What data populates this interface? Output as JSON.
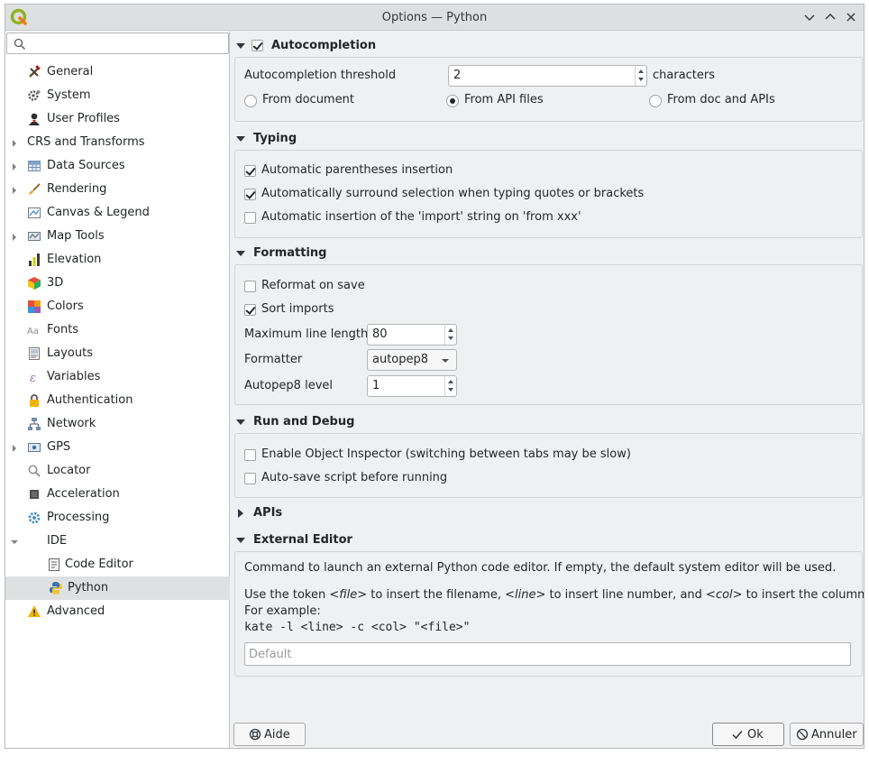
{
  "window": {
    "title": "Options — Python"
  },
  "search": {
    "placeholder": "",
    "value": ""
  },
  "sidebar": {
    "items": [
      {
        "label": "General",
        "icon": "general-icon",
        "expandable": false
      },
      {
        "label": "System",
        "icon": "system-icon",
        "expandable": false
      },
      {
        "label": "User Profiles",
        "icon": "user-profiles-icon",
        "expandable": false
      },
      {
        "label": "CRS and Transforms",
        "icon": "",
        "expandable": true
      },
      {
        "label": "Data Sources",
        "icon": "data-sources-icon",
        "expandable": true
      },
      {
        "label": "Rendering",
        "icon": "rendering-icon",
        "expandable": true
      },
      {
        "label": "Canvas & Legend",
        "icon": "canvas-legend-icon",
        "expandable": false
      },
      {
        "label": "Map Tools",
        "icon": "map-tools-icon",
        "expandable": true
      },
      {
        "label": "Elevation",
        "icon": "elevation-icon",
        "expandable": false
      },
      {
        "label": "3D",
        "icon": "3d-icon",
        "expandable": false
      },
      {
        "label": "Colors",
        "icon": "colors-icon",
        "expandable": false
      },
      {
        "label": "Fonts",
        "icon": "fonts-icon",
        "expandable": false
      },
      {
        "label": "Layouts",
        "icon": "layouts-icon",
        "expandable": false
      },
      {
        "label": "Variables",
        "icon": "variables-icon",
        "expandable": false
      },
      {
        "label": "Authentication",
        "icon": "authentication-icon",
        "expandable": false
      },
      {
        "label": "Network",
        "icon": "network-icon",
        "expandable": false
      },
      {
        "label": "GPS",
        "icon": "gps-icon",
        "expandable": true
      },
      {
        "label": "Locator",
        "icon": "locator-icon",
        "expandable": false
      },
      {
        "label": "Acceleration",
        "icon": "acceleration-icon",
        "expandable": false
      },
      {
        "label": "Processing",
        "icon": "processing-icon",
        "expandable": false
      },
      {
        "label": "IDE",
        "icon": "",
        "expandable": true
      },
      {
        "label": "Code Editor",
        "icon": "code-editor-icon",
        "expandable": false
      },
      {
        "label": "Python",
        "icon": "python-icon",
        "expandable": false
      },
      {
        "label": "Advanced",
        "icon": "advanced-warning-icon",
        "expandable": false
      }
    ],
    "selected": "Python"
  },
  "sections": {
    "autocompletion": {
      "title": "Autocompletion",
      "enabled": true,
      "threshold_label": "Autocompletion threshold",
      "threshold_value": "2",
      "threshold_suffix": "characters",
      "source_options": [
        "From document",
        "From API files",
        "From doc and APIs"
      ],
      "source_selected": "From API files"
    },
    "typing": {
      "title": "Typing",
      "options": [
        {
          "label": "Automatic parentheses insertion",
          "checked": true
        },
        {
          "label": "Automatically surround selection when typing quotes or brackets",
          "checked": true
        },
        {
          "label": "Automatic insertion of the 'import' string on 'from xxx'",
          "checked": false
        }
      ]
    },
    "formatting": {
      "title": "Formatting",
      "reformat_label": "Reformat on save",
      "reformat_checked": false,
      "sort_label": "Sort imports",
      "sort_checked": true,
      "max_line_label": "Maximum line length",
      "max_line_value": "80",
      "formatter_label": "Formatter",
      "formatter_value": "autopep8",
      "level_label": "Autopep8 level",
      "level_value": "1"
    },
    "run_debug": {
      "title": "Run and Debug",
      "options": [
        {
          "label": "Enable Object Inspector (switching between tabs may be slow)",
          "checked": false
        },
        {
          "label": "Auto-save script before running",
          "checked": false
        }
      ]
    },
    "apis": {
      "title": "APIs",
      "collapsed": true
    },
    "external_editor": {
      "title": "External Editor",
      "description": "Command to launch an external Python code editor. If empty, the default system editor will be used.",
      "token_part1": "Use the token ",
      "token_file": "<file>",
      "token_part2": " to insert the filename, ",
      "token_line": "<line>",
      "token_part3": " to insert line number, and ",
      "token_col": "<col>",
      "token_part4": " to insert the column number.",
      "example_label": "For example:",
      "example_cmd": "kate -l <line> -c <col> \"<file>\"",
      "input_placeholder": "Default",
      "input_value": ""
    }
  },
  "buttons": {
    "help": "Aide",
    "ok": "Ok",
    "cancel": "Annuler"
  },
  "colors": {
    "accent": "#3daee9",
    "qgis_green": "#589632",
    "warning": "#f0b400"
  }
}
